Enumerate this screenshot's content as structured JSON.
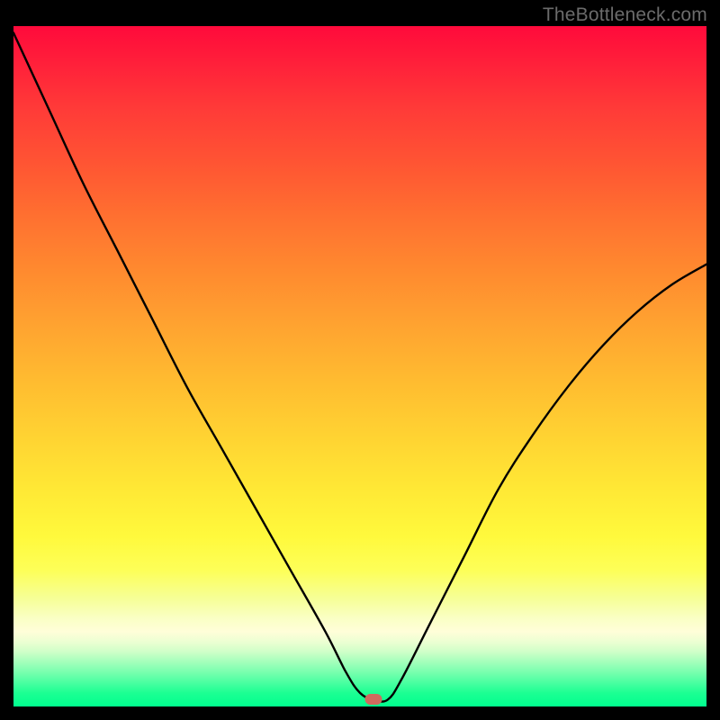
{
  "attribution": "TheBottleneck.com",
  "chart_data": {
    "type": "line",
    "title": "",
    "xlabel": "",
    "ylabel": "",
    "xlim": [
      0,
      100
    ],
    "ylim": [
      0,
      100
    ],
    "background": {
      "gradient": "vertical",
      "top_meaning": "high_bottleneck",
      "bottom_meaning": "no_bottleneck",
      "stops": [
        {
          "pos": 0,
          "color": "#ff0a3b"
        },
        {
          "pos": 50,
          "color": "#ffc531"
        },
        {
          "pos": 78,
          "color": "#fdff50"
        },
        {
          "pos": 100,
          "color": "#00fe8e"
        }
      ]
    },
    "series": [
      {
        "name": "bottleneck_curve",
        "x": [
          0,
          5,
          10,
          15,
          20,
          25,
          30,
          35,
          40,
          45,
          48,
          50,
          52,
          54,
          56,
          60,
          65,
          70,
          75,
          80,
          85,
          90,
          95,
          100
        ],
        "values": [
          99,
          88,
          77,
          67,
          57,
          47,
          38,
          29,
          20,
          11,
          5,
          2,
          1,
          1,
          4,
          12,
          22,
          32,
          40,
          47,
          53,
          58,
          62,
          65
        ]
      }
    ],
    "marker": {
      "x": 52,
      "y": 1,
      "color": "#cf6a5e",
      "shape": "rounded-rect"
    }
  }
}
